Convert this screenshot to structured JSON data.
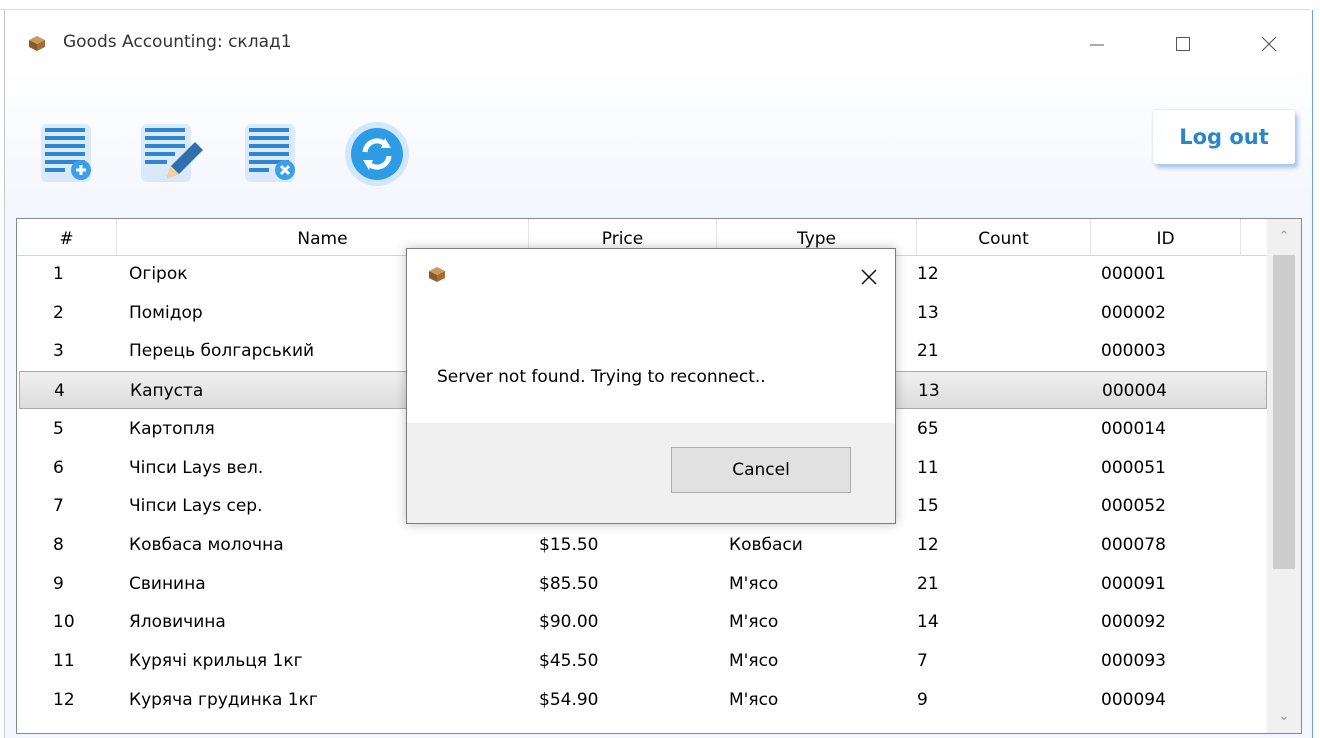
{
  "window": {
    "title": "Goods Accounting: склад1"
  },
  "toolbar": {
    "buttons": [
      {
        "icon": "add-document-icon"
      },
      {
        "icon": "edit-document-icon"
      },
      {
        "icon": "delete-document-icon"
      },
      {
        "icon": "refresh-icon"
      }
    ],
    "logout_label": "Log out"
  },
  "table": {
    "columns": [
      "#",
      "Name",
      "Price",
      "Type",
      "Count",
      "ID"
    ],
    "rows": [
      {
        "n": "1",
        "name": "Огірок",
        "price": "",
        "type": "",
        "count": "12",
        "id": "000001"
      },
      {
        "n": "2",
        "name": "Помідор",
        "price": "",
        "type": "",
        "count": "13",
        "id": "000002"
      },
      {
        "n": "3",
        "name": "Перець болгарський",
        "price": "",
        "type": "",
        "count": "21",
        "id": "000003"
      },
      {
        "n": "4",
        "name": "Капуста",
        "price": "",
        "type": "",
        "count": "13",
        "id": "000004"
      },
      {
        "n": "5",
        "name": "Картопля",
        "price": "",
        "type": "",
        "count": "65",
        "id": "000014"
      },
      {
        "n": "6",
        "name": "Чіпси Lays вел.",
        "price": "",
        "type": "",
        "count": "11",
        "id": "000051"
      },
      {
        "n": "7",
        "name": "Чіпси Lays сер.",
        "price": "",
        "type": "",
        "count": "15",
        "id": "000052"
      },
      {
        "n": "8",
        "name": "Ковбаса молочна",
        "price": "$15.50",
        "type": "Ковбаси",
        "count": "12",
        "id": "000078"
      },
      {
        "n": "9",
        "name": "Свинина",
        "price": "$85.50",
        "type": "М'ясо",
        "count": "21",
        "id": "000091"
      },
      {
        "n": "10",
        "name": "Яловичина",
        "price": "$90.00",
        "type": "М'ясо",
        "count": "14",
        "id": "000092"
      },
      {
        "n": "11",
        "name": "Курячі крильця 1кг",
        "price": "$45.50",
        "type": "М'ясо",
        "count": "7",
        "id": "000093"
      },
      {
        "n": "12",
        "name": "Куряча грудинка 1кг",
        "price": "$54.90",
        "type": "М'ясо",
        "count": "9",
        "id": "000094"
      }
    ],
    "selected_row": 4
  },
  "dialog": {
    "message": "Server not found. Trying to reconnect..",
    "cancel_label": "Cancel"
  },
  "colors": {
    "accent": "#2a86c9",
    "window_border": "#6a9fd9"
  }
}
